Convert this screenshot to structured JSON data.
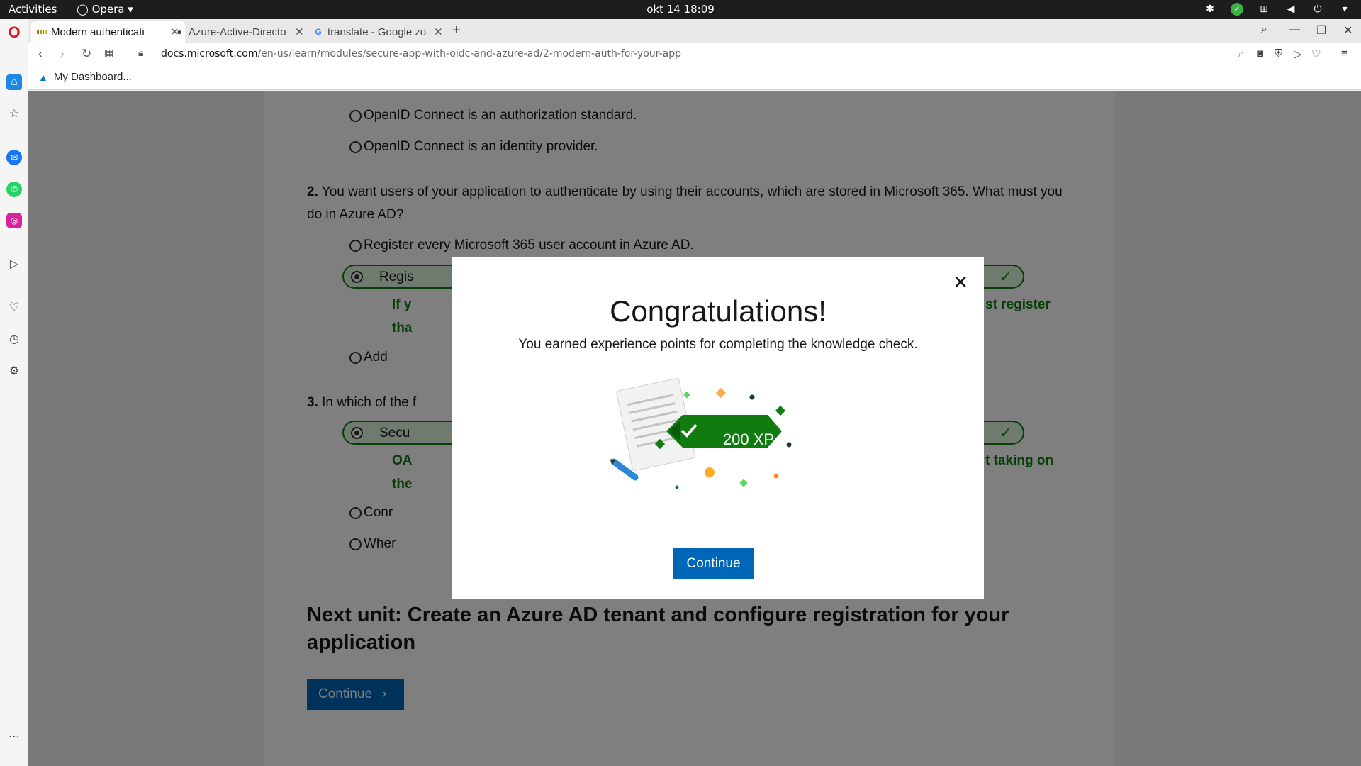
{
  "system": {
    "activities": "Activities",
    "app_name": "Opera",
    "clock": "okt 14  18:09"
  },
  "tabs": [
    {
      "title": "Modern authenticati"
    },
    {
      "title": "Azure-Active-Directo"
    },
    {
      "title": "translate - Google zo"
    }
  ],
  "address": {
    "domain": "docs.microsoft.com",
    "path": "/en-us/learn/modules/secure-app-with-oidc-and-azure-ad/2-modern-auth-for-your-app"
  },
  "bookmarks": [
    {
      "label": "My Dashboard..."
    }
  ],
  "page": {
    "q1_options": [
      "OpenID Connect is an authorization standard.",
      "OpenID Connect is an identity provider."
    ],
    "q2_number": "2.",
    "q2_text": "You want users of your application to authenticate by using their accounts, which are stored in Microsoft 365. What must you do in Azure AD?",
    "q2_options": [
      "Register every Microsoft 365 user account in Azure AD.",
      "Regis",
      "Add"
    ],
    "q2_explain_left_1": "If y",
    "q2_explain_right_1": "st register",
    "q2_explain_left_2": "tha",
    "q3_number": "3.",
    "q3_text": "In which of the f",
    "q3_options": [
      "Secu",
      "Conr",
      "Wher"
    ],
    "q3_explain_left_1": "OA",
    "q3_explain_right_1": "t taking on",
    "q3_explain_left_2": "the",
    "next_unit_title": "Next unit: Create an Azure AD tenant and configure registration for your application",
    "next_button": "Continue"
  },
  "modal": {
    "title": "Congratulations!",
    "subtitle": "You earned experience points for completing the knowledge check.",
    "xp": "200 XP",
    "continue_label": "Continue"
  },
  "colors": {
    "accent": "#0067b8",
    "correct_green": "#107c10",
    "xp_green": "#107c10"
  }
}
